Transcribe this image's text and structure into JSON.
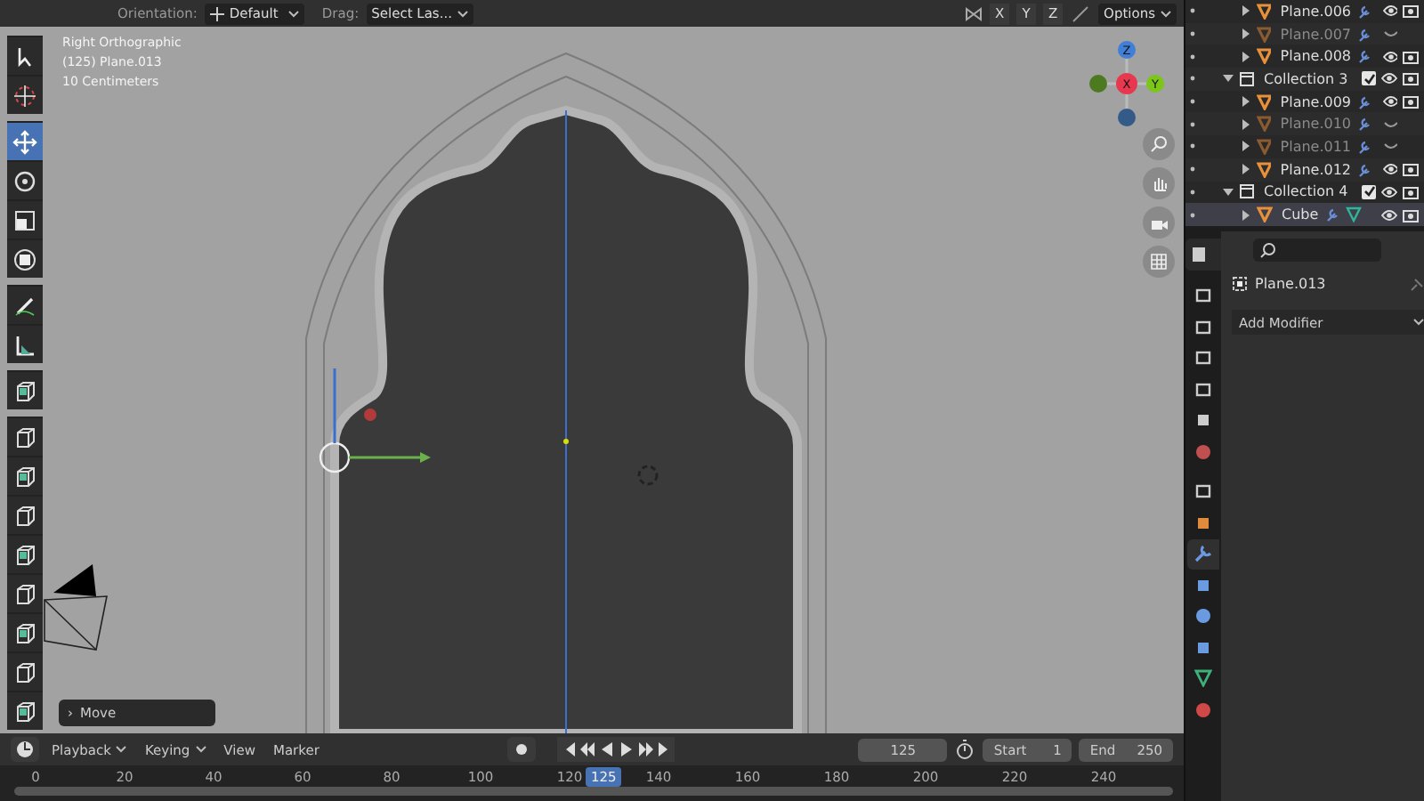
{
  "header": {
    "orientation_label": "Orientation:",
    "orientation_value": "Default",
    "drag_label": "Drag:",
    "drag_value": "Select Las...",
    "axes": [
      "X",
      "Y",
      "Z"
    ],
    "options": "Options"
  },
  "viewport": {
    "info": [
      "Right Orthographic",
      "(125) Plane.013",
      "10 Centimeters"
    ],
    "tool_groups": [
      [
        {
          "selected": false
        },
        {
          "selected": false
        }
      ],
      [
        {
          "selected": true
        },
        {
          "selected": false
        },
        {
          "selected": false
        },
        {
          "selected": false
        }
      ],
      [
        {
          "selected": false
        },
        {
          "selected": false
        }
      ],
      [
        {
          "selected": false
        }
      ],
      [
        {
          "selected": false
        },
        {
          "selected": false
        },
        {
          "selected": false
        },
        {
          "selected": false
        },
        {
          "selected": false
        },
        {
          "selected": false
        },
        {
          "selected": false
        },
        {
          "selected": false
        }
      ]
    ],
    "gizmo_axes": [
      "Z",
      "X",
      "Y"
    ],
    "operator_panel": {
      "arrow": "›",
      "label": "Move"
    }
  },
  "outliner": {
    "rows": [
      {
        "kind": "object",
        "name": "Plane.006",
        "hidden": false,
        "selected": false
      },
      {
        "kind": "object",
        "name": "Plane.007",
        "hidden": true,
        "selected": false
      },
      {
        "kind": "object",
        "name": "Plane.008",
        "hidden": false,
        "selected": false
      },
      {
        "kind": "collection",
        "name": "Collection 3",
        "checked": true,
        "children": [
          {
            "kind": "object",
            "name": "Plane.009",
            "hidden": false,
            "selected": false
          },
          {
            "kind": "object",
            "name": "Plane.010",
            "hidden": true,
            "selected": false
          },
          {
            "kind": "object",
            "name": "Plane.011",
            "hidden": true,
            "selected": false
          },
          {
            "kind": "object",
            "name": "Plane.012",
            "hidden": false,
            "selected": false
          }
        ]
      },
      {
        "kind": "collection",
        "name": "Collection 4",
        "checked": true,
        "children": [
          {
            "kind": "object",
            "name": "Cube",
            "hidden": false,
            "selected": true
          }
        ]
      }
    ]
  },
  "properties": {
    "tabs": [
      {
        "selected": false
      },
      {
        "selected": false
      },
      {
        "selected": false
      },
      {
        "selected": false
      },
      {
        "selected": false
      },
      {
        "selected": false
      },
      {
        "selected": false
      },
      {
        "selected": false
      },
      {
        "selected": true
      },
      {
        "selected": false
      },
      {
        "selected": false
      },
      {
        "selected": false
      },
      {
        "selected": false
      },
      {
        "selected": false
      }
    ],
    "object_name": "Plane.013",
    "add_modifier": "Add Modifier"
  },
  "timeline": {
    "menus": [
      {
        "label": "Playback",
        "dropdown": true
      },
      {
        "label": "Keying",
        "dropdown": true
      },
      {
        "label": "View",
        "dropdown": false
      },
      {
        "label": "Marker",
        "dropdown": false
      }
    ],
    "current_frame": "125",
    "start_label": "Start",
    "start": "1",
    "end_label": "End",
    "end": "250",
    "ruler": [
      "0",
      "20",
      "40",
      "60",
      "80",
      "100",
      "120",
      "140",
      "160",
      "180",
      "200",
      "220",
      "240"
    ],
    "ruler_current": "125"
  }
}
